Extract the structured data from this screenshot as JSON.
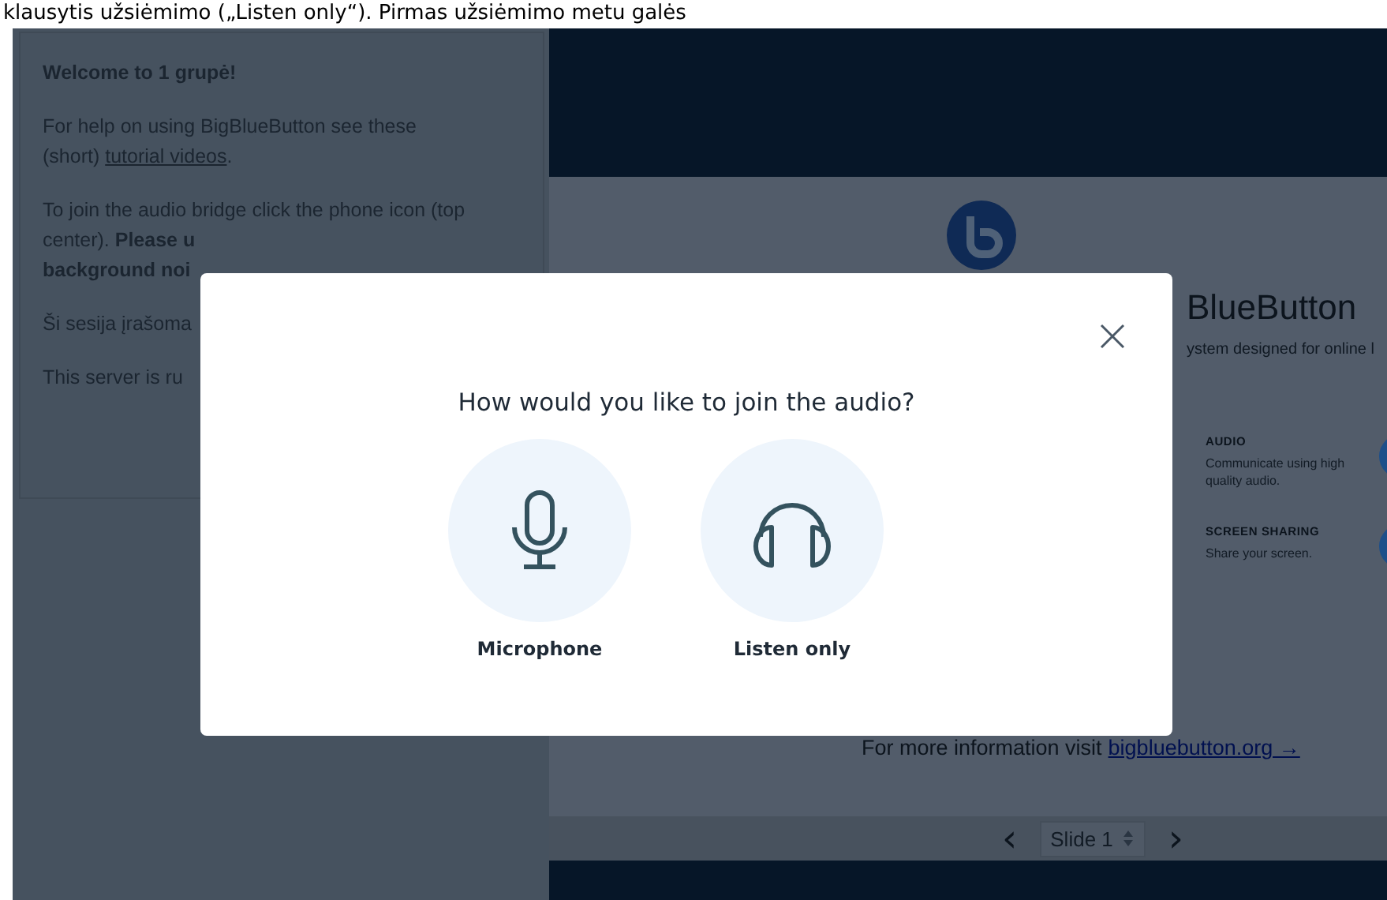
{
  "caption": "klausytis užsiėmimo („Listen only“). Pirmas užsiėmimo metu galės",
  "welcome_panel": {
    "paragraphs": [
      {
        "kind": "heading",
        "lines": [
          "Welcome to 1 grupė!"
        ]
      },
      {
        "kind": "link",
        "lines": [
          "For help on using BigBlueButton see these",
          "(short)"
        ],
        "link": "tutorial videos",
        "after": "."
      },
      {
        "kind": "text",
        "lines": [
          "To join the audio bridge click the phone icon (top",
          "center). **Please u**",
          "**background noi**"
        ]
      },
      {
        "kind": "text",
        "lines": [
          "Ši sesija įrašoma"
        ]
      },
      {
        "kind": "text",
        "lines": [
          "This server is ru"
        ]
      }
    ]
  },
  "slide": {
    "title": "BlueButton",
    "subtitle": "ystem designed for online l",
    "features": [
      {
        "title": "AUDIO",
        "text": "Communicate using high quality audio."
      },
      {
        "title": "SCREEN SHARING",
        "text": "Share your screen."
      }
    ],
    "footer": "For more information visit",
    "footer_link": "bigbluebutton.org →"
  },
  "slide_bar": {
    "prev": "‹",
    "slide_select": "Slide 1",
    "next": "›"
  },
  "modal": {
    "title": "How would you like to join the audio?",
    "options": [
      {
        "kind": "microphone",
        "label": "Microphone"
      },
      {
        "kind": "listen",
        "label": "Listen only"
      }
    ]
  }
}
